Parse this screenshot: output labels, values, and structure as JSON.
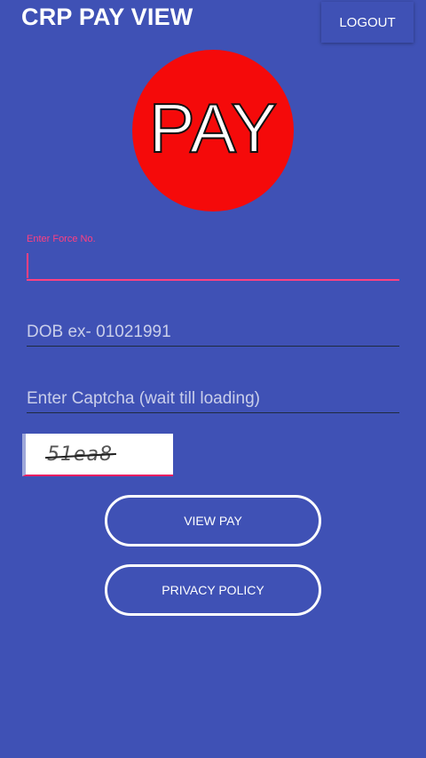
{
  "header": {
    "title": "CRP PAY VIEW",
    "logout_label": "LOGOUT"
  },
  "logo": {
    "text": "PAY",
    "circle_color": "#f50a0a"
  },
  "form": {
    "force_no": {
      "label": "Enter Force No.",
      "value": ""
    },
    "dob": {
      "placeholder": "DOB ex- 01021991",
      "value": ""
    },
    "captcha_input": {
      "placeholder": "Enter Captcha (wait till loading)",
      "value": ""
    },
    "captcha_image_text": "51ea8"
  },
  "buttons": {
    "view_pay": "VIEW PAY",
    "privacy_policy": "PRIVACY POLICY"
  },
  "colors": {
    "background": "#3f51b5",
    "accent": "#ff4081"
  }
}
